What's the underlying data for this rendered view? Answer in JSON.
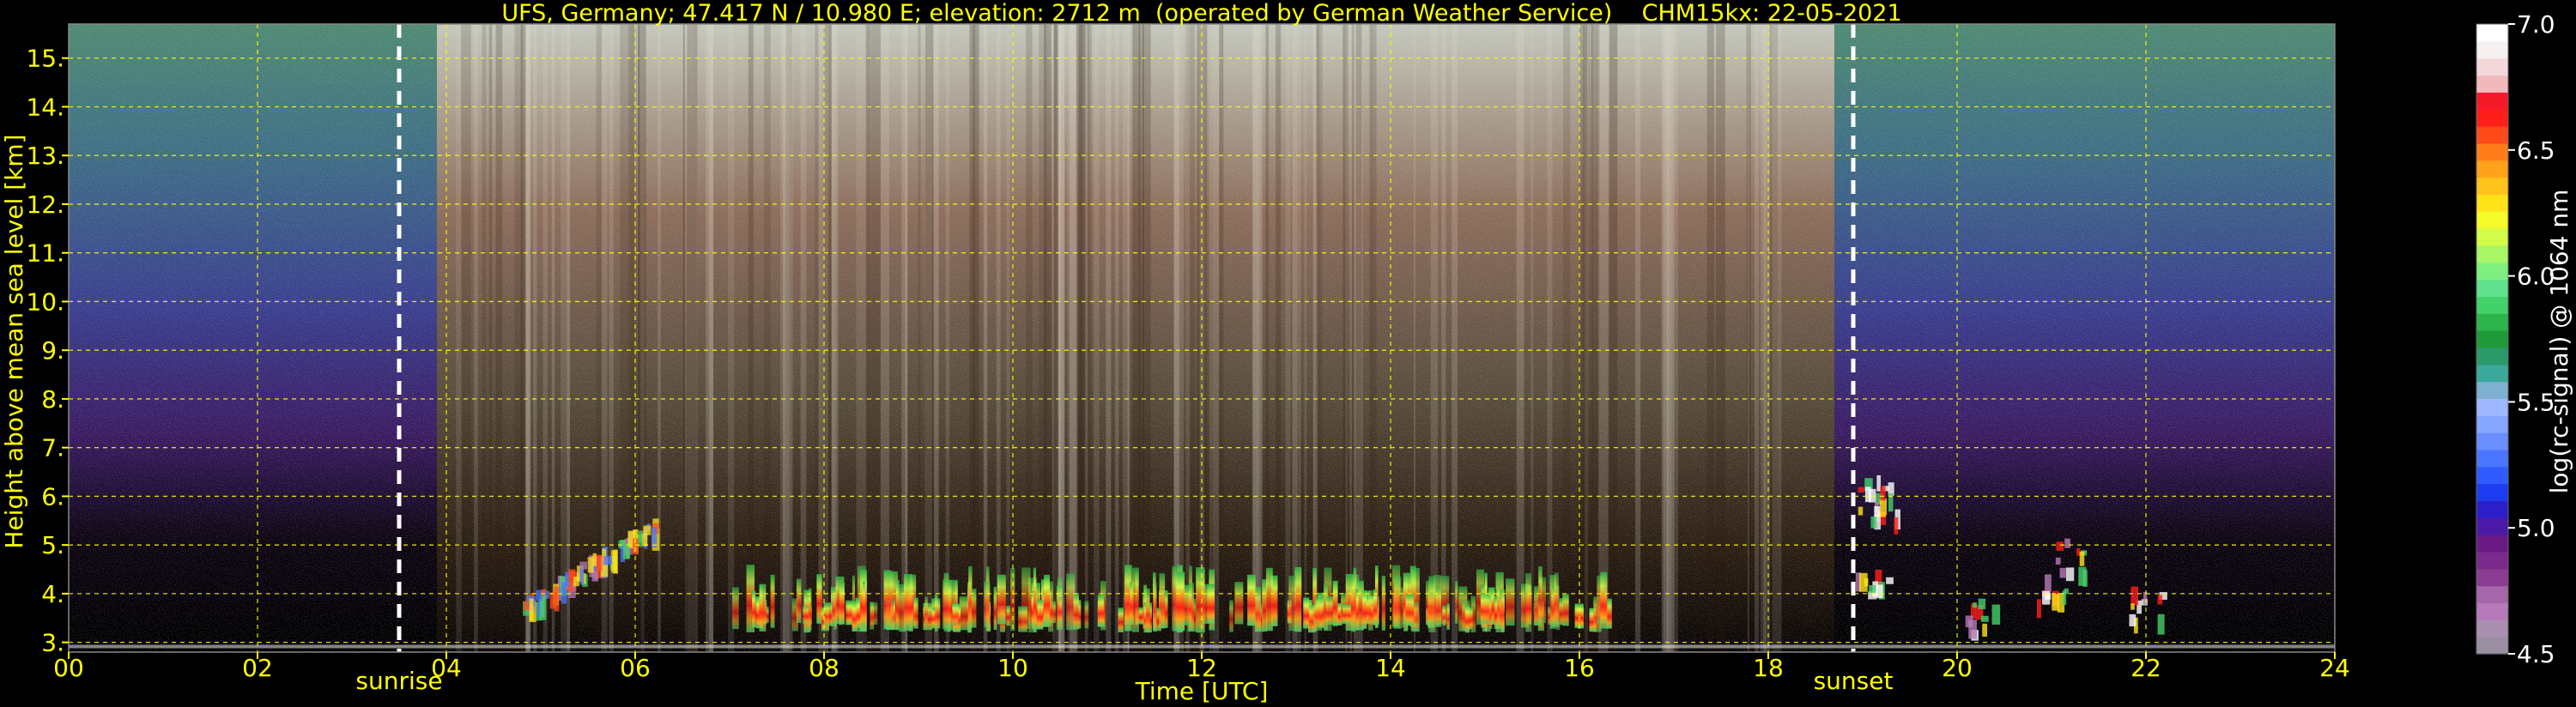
{
  "chart_data": {
    "type": "heatmap",
    "title": "UFS, Germany; 47.417 N / 10.980 E; elevation: 2712 m  (operated by German Weather Service)    CHM15kx: 22-05-2021",
    "xlabel": "Time [UTC]",
    "ylabel": "Height above mean sea level [km]",
    "colorbar_label": "log(rc-signal) @ 1064 nm",
    "xlim": [
      0,
      24
    ],
    "ylim": [
      2.8,
      15.7
    ],
    "clim": [
      4.5,
      7.0
    ],
    "grid": true,
    "x_ticks": [
      {
        "value": 0,
        "label": "00"
      },
      {
        "value": 2,
        "label": "02"
      },
      {
        "value": 4,
        "label": "04"
      },
      {
        "value": 6,
        "label": "06"
      },
      {
        "value": 8,
        "label": "08"
      },
      {
        "value": 10,
        "label": "10"
      },
      {
        "value": 12,
        "label": "12"
      },
      {
        "value": 14,
        "label": "14"
      },
      {
        "value": 16,
        "label": "16"
      },
      {
        "value": 18,
        "label": "18"
      },
      {
        "value": 20,
        "label": "20"
      },
      {
        "value": 22,
        "label": "22"
      },
      {
        "value": 24,
        "label": "24"
      }
    ],
    "y_ticks": [
      {
        "value": 3,
        "label": "3."
      },
      {
        "value": 4,
        "label": "4."
      },
      {
        "value": 5,
        "label": "5."
      },
      {
        "value": 6,
        "label": "6."
      },
      {
        "value": 7,
        "label": "7."
      },
      {
        "value": 8,
        "label": "8."
      },
      {
        "value": 9,
        "label": "9."
      },
      {
        "value": 10,
        "label": "10."
      },
      {
        "value": 11,
        "label": "11."
      },
      {
        "value": 12,
        "label": "12."
      },
      {
        "value": 13,
        "label": "13."
      },
      {
        "value": 14,
        "label": "14."
      },
      {
        "value": 15,
        "label": "15."
      }
    ],
    "colorbar_ticks": [
      {
        "value": 4.5,
        "label": "4.5"
      },
      {
        "value": 5.0,
        "label": "5.0"
      },
      {
        "value": 5.5,
        "label": "5.5"
      },
      {
        "value": 6.0,
        "label": "6.0"
      },
      {
        "value": 6.5,
        "label": "6.5"
      },
      {
        "value": 7.0,
        "label": "7.0"
      }
    ],
    "markers": [
      {
        "label": "sunrise",
        "x": 3.5
      },
      {
        "label": "sunset",
        "x": 18.9
      }
    ],
    "colorbar_colors": [
      "#9b8fa3",
      "#a98fb0",
      "#b67ab9",
      "#a566aa",
      "#8a3d93",
      "#7a2a8a",
      "#6a1a86",
      "#4b1aa8",
      "#2c1ec8",
      "#1f3bf0",
      "#2f5bff",
      "#4a75ff",
      "#6a8eff",
      "#86a6ff",
      "#9fb8ff",
      "#7fb0d0",
      "#3aa89a",
      "#2a9a6a",
      "#1f9a38",
      "#2bb54a",
      "#43d16a",
      "#5fe08c",
      "#7ff07f",
      "#a8f566",
      "#d2fb4a",
      "#f4fb2a",
      "#ffe31a",
      "#ffc21a",
      "#ffa21a",
      "#ff7d1a",
      "#ff4a1a",
      "#ff1f1a",
      "#f51a2a",
      "#f2b9bd",
      "#f4d7d9",
      "#f7f0f0",
      "#ffffff"
    ]
  }
}
